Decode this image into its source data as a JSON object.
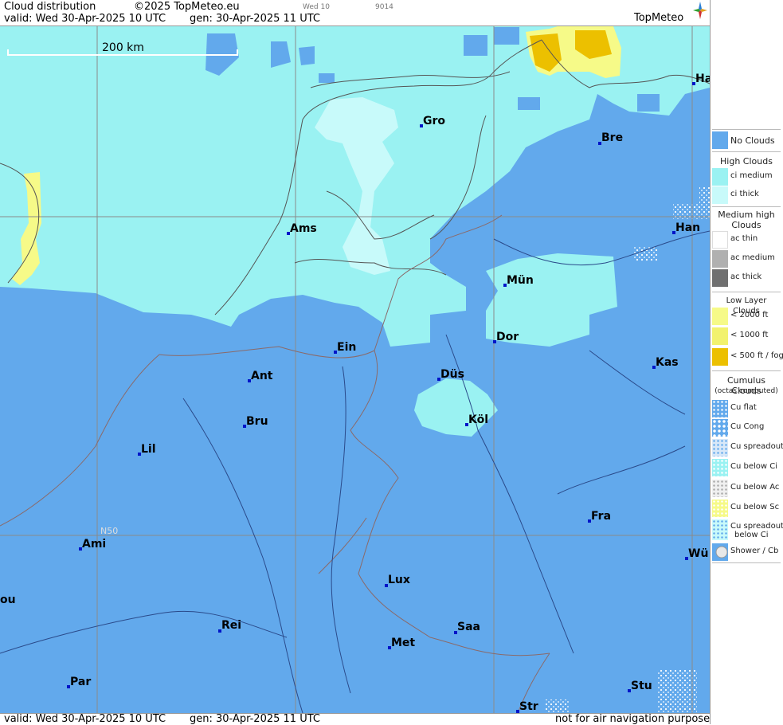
{
  "header": {
    "title": "Cloud distribution",
    "copyright": "©2025 TopMeteo.eu",
    "small_day": "Wed 10",
    "small_code": "9014",
    "valid": "valid:  Wed  30-Apr-2025  10 UTC",
    "generated": "gen: 30-Apr-2025 11 UTC",
    "logo_text": "TopMeteo"
  },
  "map": {
    "scale_label": "200 km",
    "grid_label": "N50",
    "cities": [
      {
        "label": "Gro"
      },
      {
        "label": "Bre"
      },
      {
        "label": "Ha"
      },
      {
        "label": "Ams"
      },
      {
        "label": "Han"
      },
      {
        "label": "Mün"
      },
      {
        "label": "Dor"
      },
      {
        "label": "Ein"
      },
      {
        "label": "Kas"
      },
      {
        "label": "Ant"
      },
      {
        "label": "Düs"
      },
      {
        "label": "Köl"
      },
      {
        "label": "Bru"
      },
      {
        "label": "Lil"
      },
      {
        "label": "Fra"
      },
      {
        "label": "Ami"
      },
      {
        "label": "Wü"
      },
      {
        "label": "ou"
      },
      {
        "label": "Lux"
      },
      {
        "label": "Rei"
      },
      {
        "label": "Saa"
      },
      {
        "label": "Met"
      },
      {
        "label": "Par"
      },
      {
        "label": "Stu"
      },
      {
        "label": "Str"
      }
    ]
  },
  "legend": {
    "no_clouds": "No Clouds",
    "high_title": "High Clouds",
    "ci_medium": "ci medium",
    "ci_thick": "ci thick",
    "medium_title": "Medium high Clouds",
    "ac_thin": "ac thin",
    "ac_medium": "ac medium",
    "ac_thick": "ac thick",
    "low_title": "Low Layer Clouds",
    "low_2000": "< 2000 ft",
    "low_1000": "< 1000 ft",
    "low_500": "< 500 ft / fog",
    "cu_title": "Cumulus Clouds",
    "cu_sub": "(octas computed)",
    "cu_flat": "Cu flat",
    "cu_cong": "Cu Cong",
    "cu_spreadout": "Cu spreadout",
    "cu_below_ci": "Cu below Ci",
    "cu_below_ac": "Cu below Ac",
    "cu_below_sc": "Cu below Sc",
    "cu_spread_below_ci_1": "Cu spreadout",
    "cu_spread_below_ci_2": "below Ci",
    "shower": "Shower / Cb"
  },
  "footer": {
    "valid": "valid:  Wed  30-Apr-2025  10 UTC",
    "generated": "gen: 30-Apr-2025 11 UTC",
    "note": "not for air navigation purposes"
  },
  "colors": {
    "no_clouds": "#62a9ec",
    "ci_medium": "#9af2f2",
    "ci_thick": "#c8fafa",
    "low_2000": "#f6fa88",
    "low_1000": "#f2f26e",
    "low_500": "#ecc000"
  }
}
